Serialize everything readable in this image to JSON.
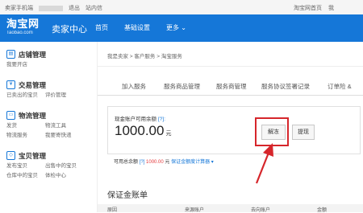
{
  "topbar": {
    "left_account": "卖家手机端",
    "left_logout": "退出",
    "left_messages": "站内信",
    "right_home": "淘宝网首页",
    "right_mytaobao": "我"
  },
  "header": {
    "logo_cn": "淘宝网",
    "logo_en": "Taobao.com",
    "seller_center": "卖家中心",
    "nav": [
      "首页",
      "基础设置",
      "更多 ⌄"
    ]
  },
  "sidebar": [
    {
      "icon": "store-icon",
      "title": "店铺管理",
      "links": [
        "我要开店"
      ]
    },
    {
      "icon": "trade-icon",
      "title": "交易管理",
      "links": [
        "已卖出的宝贝",
        "评价管理"
      ]
    },
    {
      "icon": "logistics-icon",
      "title": "物流管理",
      "links": [
        "发货",
        "物流工具",
        "物流服务",
        "我要寄快递"
      ]
    },
    {
      "icon": "goods-icon",
      "title": "宝贝管理",
      "links": [
        "发布宝贝",
        "出售中的宝贝",
        "仓库中的宝贝",
        "体检中心"
      ]
    }
  ],
  "breadcrumb": "我是卖家  >  客户服务  >  淘宝服务",
  "tabs": [
    "加入服务",
    "服务商品管理",
    "服务商管理",
    "服务协议签署记录",
    "订单险 &"
  ],
  "balance": {
    "label": "现金账户可用余额",
    "help": "[?]:",
    "amount": "1000.00",
    "unit": "元",
    "unfreeze_label": "解冻",
    "withdraw_label": "提现"
  },
  "total": {
    "label": "可用总余额",
    "help": "[?]",
    "amount": "1000.00",
    "unit": "元",
    "link": "保证金额度计算器 ▾"
  },
  "deposit_title": "保证金账单",
  "table_columns": [
    "原因",
    "来源账户",
    "去向账户",
    "金额"
  ],
  "colors": {
    "brand_blue": "#1577d8",
    "highlight_red": "#d6262b"
  }
}
